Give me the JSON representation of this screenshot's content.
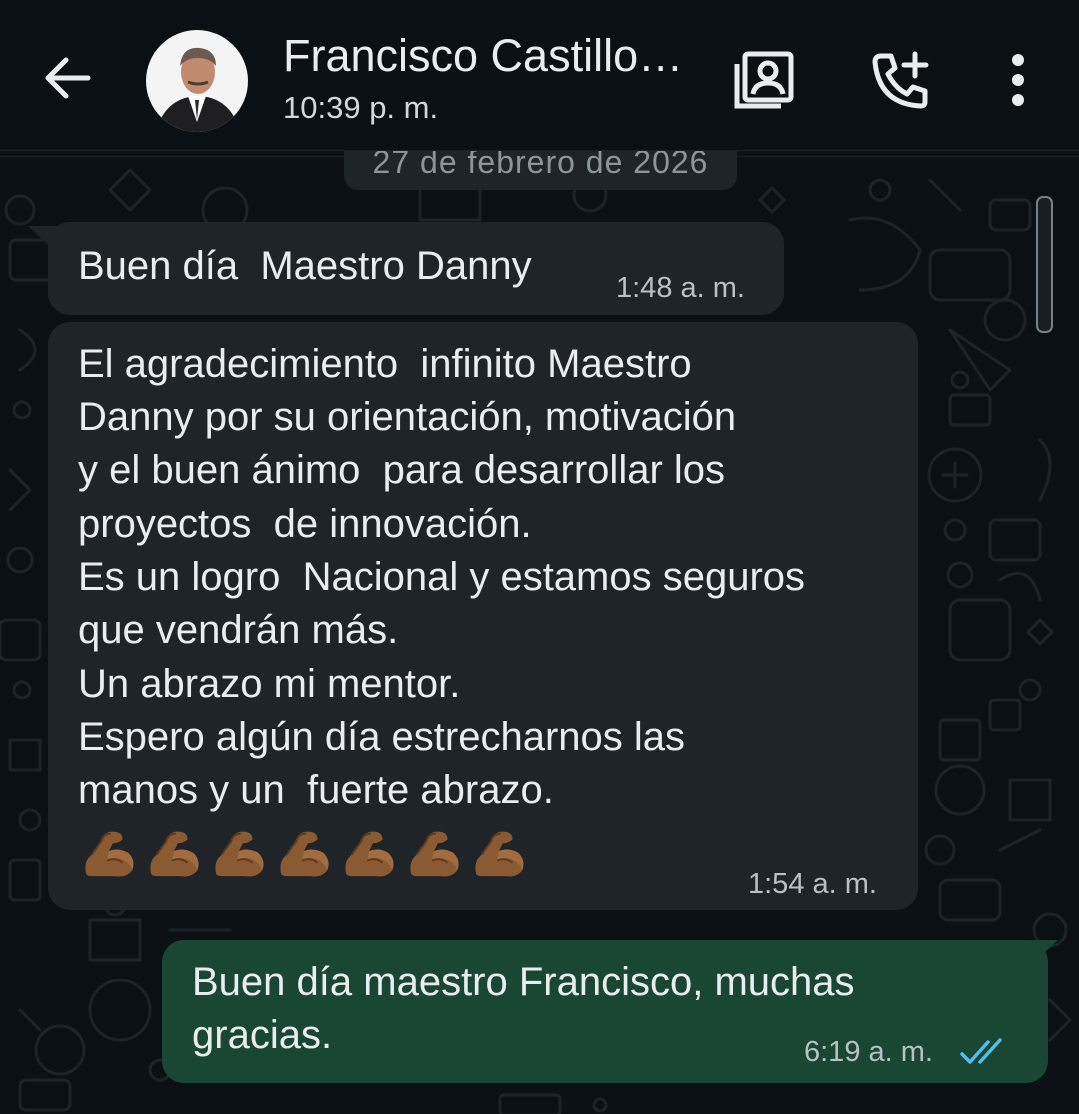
{
  "header": {
    "contact_name": "Francisco Castillo…",
    "last_seen": "10:39 p. m.",
    "icons": [
      "back-arrow-icon",
      "contact-avatar",
      "video-library-icon",
      "call-add-icon",
      "more-vert-icon"
    ]
  },
  "date_chip": "27 de febrero de 2026",
  "messages": [
    {
      "direction": "in",
      "text": "Buen día  Maestro Danny",
      "time": "1:48 a. m."
    },
    {
      "direction": "in",
      "lines": [
        "El agradecimiento  infinito Maestro",
        "Danny por su orientación, motivación",
        "y el buen ánimo  para desarrollar los",
        "proyectos  de innovación.",
        "Es un logro  Nacional y estamos seguros",
        "que vendrán más.",
        "Un abrazo mi mentor.",
        "Espero algún día estrecharnos las",
        "manos y un  fuerte abrazo."
      ],
      "emoji": "💪🏾💪🏾💪🏾💪🏾💪🏾💪🏾💪🏾",
      "emoji_count": 7,
      "time": "1:54 a. m."
    },
    {
      "direction": "out",
      "lines": [
        "Buen día maestro Francisco, muchas",
        "gracias."
      ],
      "time": "6:19 a. m.",
      "status": "read-double-check-icon"
    }
  ],
  "colors": {
    "background": "#0b1014",
    "incoming_bubble": "#1f2428",
    "outgoing_bubble": "#1a4733",
    "read_ticks": "#53bdeb",
    "timestamp": "#b7c1c6"
  }
}
